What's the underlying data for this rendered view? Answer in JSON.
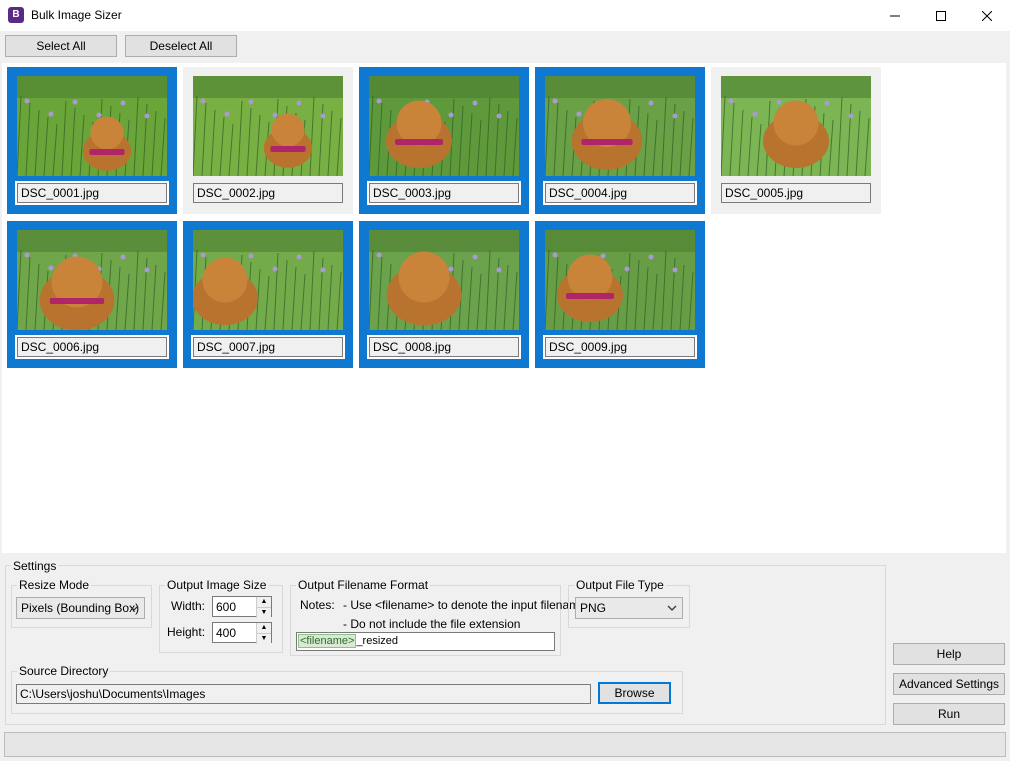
{
  "window": {
    "title": "Bulk Image Sizer",
    "icon_letter": "B"
  },
  "toolbar": {
    "select_all": "Select All",
    "deselect_all": "Deselect All"
  },
  "images": [
    {
      "filename": "DSC_0001.jpg",
      "selected": true
    },
    {
      "filename": "DSC_0002.jpg",
      "selected": false
    },
    {
      "filename": "DSC_0003.jpg",
      "selected": true
    },
    {
      "filename": "DSC_0004.jpg",
      "selected": true
    },
    {
      "filename": "DSC_0005.jpg",
      "selected": false
    },
    {
      "filename": "DSC_0006.jpg",
      "selected": true
    },
    {
      "filename": "DSC_0007.jpg",
      "selected": true
    },
    {
      "filename": "DSC_0008.jpg",
      "selected": true
    },
    {
      "filename": "DSC_0009.jpg",
      "selected": true
    }
  ],
  "settings": {
    "label": "Settings",
    "resize_mode": {
      "label": "Resize Mode",
      "value": "Pixels (Bounding Box)"
    },
    "output_size": {
      "label": "Output Image Size",
      "width_label": "Width:",
      "width": "600",
      "height_label": "Height:",
      "height": "400"
    },
    "filename_format": {
      "label": "Output Filename Format",
      "notes_label": "Notes:",
      "note1": "- Use <filename> to denote the input filename",
      "note2": "- Do not include the file extension",
      "token": "<filename>",
      "suffix": "_resized"
    },
    "file_type": {
      "label": "Output File Type",
      "value": "PNG"
    },
    "source_dir": {
      "label": "Source Directory",
      "path": "C:\\Users\\joshu\\Documents\\Images",
      "browse": "Browse"
    }
  },
  "actions": {
    "help": "Help",
    "advanced": "Advanced Settings",
    "run": "Run"
  },
  "colors": {
    "selection": "#0f78d0",
    "title_icon": "#5b2a86"
  }
}
